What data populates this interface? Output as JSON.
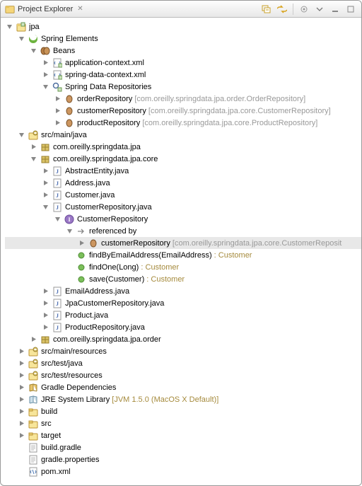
{
  "header": {
    "title": "Project Explorer"
  },
  "tree": {
    "project": "jpa",
    "spring_elements": "Spring Elements",
    "beans": "Beans",
    "app_ctx": "application-context.xml",
    "spring_ctx": "spring-data-context.xml",
    "sdr": "Spring Data Repositories",
    "repo_order": "orderRepository",
    "repo_order_q": "[com.oreilly.springdata.jpa.order.OrderRepository]",
    "repo_customer": "customerRepository",
    "repo_customer_q": "[com.oreilly.springdata.jpa.core.CustomerRepository]",
    "repo_product": "productRepository",
    "repo_product_q": "[com.oreilly.springdata.jpa.core.ProductRepository]",
    "src_main_java": "src/main/java",
    "pkg_jpa": "com.oreilly.springdata.jpa",
    "pkg_core": "com.oreilly.springdata.jpa.core",
    "f_abstract": "AbstractEntity.java",
    "f_address": "Address.java",
    "f_customer": "Customer.java",
    "f_custrepo": "CustomerRepository.java",
    "i_custrepo": "CustomerRepository",
    "refby": "referenced by",
    "refby_item": "customerRepository",
    "refby_item_q": "[com.oreilly.springdata.jpa.core.CustomerReposit",
    "m_find_email": "findByEmailAddress(EmailAddress)",
    "m_find_one": "findOne(Long)",
    "m_save": "save(Customer)",
    "ret_customer": " : Customer",
    "f_email": "EmailAddress.java",
    "f_jpacust": "JpaCustomerRepository.java",
    "f_product": "Product.java",
    "f_prodrepo": "ProductRepository.java",
    "pkg_order": "com.oreilly.springdata.jpa.order",
    "src_main_res": "src/main/resources",
    "src_test_java": "src/test/java",
    "src_test_res": "src/test/resources",
    "gradle_deps": "Gradle Dependencies",
    "jre": "JRE System Library",
    "jre_q": "[JVM 1.5.0 (MacOS X Default)]",
    "build": "build",
    "src_folder": "src",
    "target": "target",
    "build_gradle": "build.gradle",
    "gradle_props": "gradle.properties",
    "pom": "pom.xml"
  }
}
